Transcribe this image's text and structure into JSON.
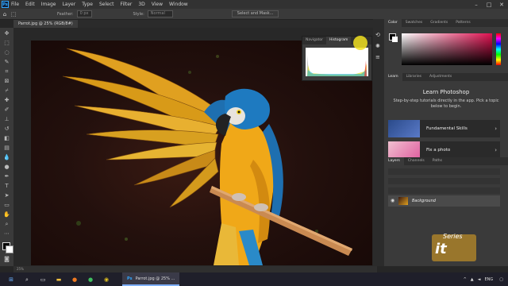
{
  "menubar": {
    "app_icon": "Ps",
    "items": [
      "File",
      "Edit",
      "Image",
      "Layer",
      "Type",
      "Select",
      "Filter",
      "3D",
      "View",
      "Window"
    ],
    "controls": [
      "minimize-icon",
      "maximize-icon",
      "close-icon"
    ]
  },
  "options_bar": {
    "feather_label": "Feather:",
    "feather_value": "0 px",
    "style_label": "Style:",
    "style_value": "Normal",
    "select_mask_button": "Select and Mask..."
  },
  "document_tab": {
    "label": "Parrot.jpg @ 25% (RGB/8#)"
  },
  "navigator_panel": {
    "tabs": [
      "Navigator",
      "Histogram"
    ],
    "active_tab": "Histogram"
  },
  "right_panel": {
    "top_tabs": [
      "Color",
      "Swatches",
      "Gradients",
      "Patterns"
    ],
    "learn_tabs": [
      "Learn",
      "Libraries",
      "Adjustments"
    ],
    "learn_title": "Learn Photoshop",
    "learn_desc": "Step-by-step tutorials directly in the app. Pick a topic below to begin.",
    "cards": [
      {
        "label": "Fundamental Skills"
      },
      {
        "label": "Fix a photo"
      }
    ],
    "layers_tabs": [
      "Layers",
      "Channels",
      "Paths"
    ],
    "layer_name": "Background"
  },
  "status_bar": {
    "zoom": "25%"
  },
  "taskbar": {
    "app_label": "Parrot.jpg @ 25% ...",
    "language": "ENG"
  },
  "watermark": {
    "text": "Series",
    "logo": "it"
  },
  "colors": {
    "accent": "#31a8ff",
    "panel_bg": "#3a3a3a",
    "canvas_bg": "#282828"
  }
}
